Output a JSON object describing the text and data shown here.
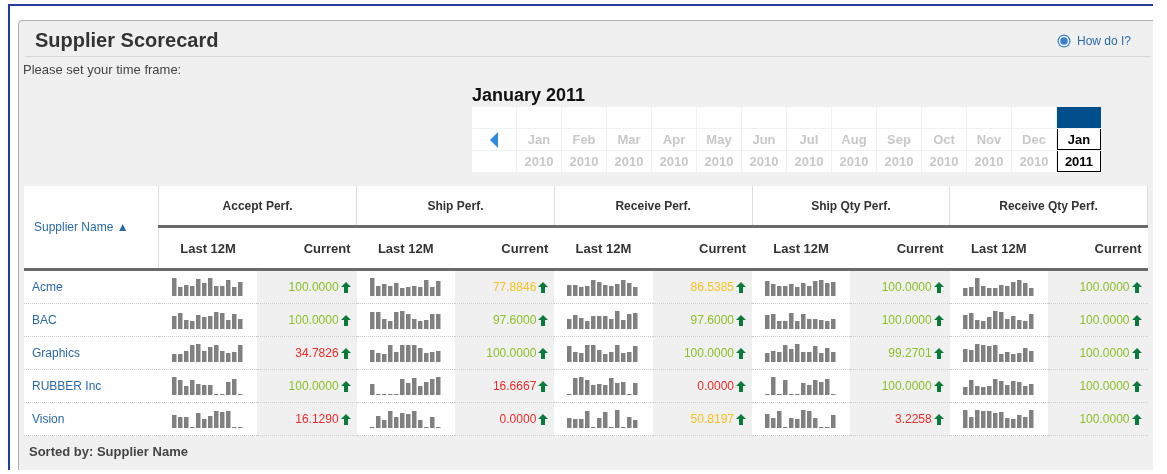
{
  "title": "Supplier Scorecard",
  "help_link": "How do I?",
  "time_frame_label": "Please set your time frame:",
  "calendar": {
    "title": "January 2011",
    "months": [
      {
        "month": "Jan",
        "year": "2010",
        "selected": false
      },
      {
        "month": "Feb",
        "year": "2010",
        "selected": false
      },
      {
        "month": "Mar",
        "year": "2010",
        "selected": false
      },
      {
        "month": "Apr",
        "year": "2010",
        "selected": false
      },
      {
        "month": "May",
        "year": "2010",
        "selected": false
      },
      {
        "month": "Jun",
        "year": "2010",
        "selected": false
      },
      {
        "month": "Jul",
        "year": "2010",
        "selected": false
      },
      {
        "month": "Aug",
        "year": "2010",
        "selected": false
      },
      {
        "month": "Sep",
        "year": "2010",
        "selected": false
      },
      {
        "month": "Oct",
        "year": "2010",
        "selected": false
      },
      {
        "month": "Nov",
        "year": "2010",
        "selected": false
      },
      {
        "month": "Dec",
        "year": "2010",
        "selected": false
      },
      {
        "month": "Jan",
        "year": "2011",
        "selected": true
      }
    ]
  },
  "table": {
    "name_column": "Supplier Name",
    "sort_arrow": "▲",
    "groups": [
      {
        "label": "Accept Perf.",
        "columns": [
          "Last 12M",
          "Current"
        ]
      },
      {
        "label": "Ship Perf.",
        "columns": [
          "Last 12M",
          "Current"
        ]
      },
      {
        "label": "Receive Perf.",
        "columns": [
          "Last 12M",
          "Current"
        ]
      },
      {
        "label": "Ship Qty Perf.",
        "columns": [
          "Last 12M",
          "Current"
        ]
      },
      {
        "label": "Receive Qty Perf.",
        "columns": [
          "Last 12M",
          "Current"
        ]
      }
    ],
    "rows": [
      {
        "name": "Acme",
        "cells": [
          {
            "current": "100.0000",
            "color": "#8cbf26"
          },
          {
            "current": "77.8846",
            "color": "#f5c223"
          },
          {
            "current": "86.5385",
            "color": "#f5c223"
          },
          {
            "current": "100.0000",
            "color": "#8cbf26"
          },
          {
            "current": "100.0000",
            "color": "#8cbf26"
          }
        ]
      },
      {
        "name": "BAC",
        "cells": [
          {
            "current": "100.0000",
            "color": "#8cbf26"
          },
          {
            "current": "97.6000",
            "color": "#8cbf26"
          },
          {
            "current": "97.6000",
            "color": "#8cbf26"
          },
          {
            "current": "100.0000",
            "color": "#8cbf26"
          },
          {
            "current": "100.0000",
            "color": "#8cbf26"
          }
        ]
      },
      {
        "name": "Graphics",
        "cells": [
          {
            "current": "34.7826",
            "color": "#ee2a2a"
          },
          {
            "current": "100.0000",
            "color": "#8cbf26"
          },
          {
            "current": "100.0000",
            "color": "#8cbf26"
          },
          {
            "current": "99.2701",
            "color": "#8cbf26"
          },
          {
            "current": "100.0000",
            "color": "#8cbf26"
          }
        ]
      },
      {
        "name": "RUBBER Inc",
        "cells": [
          {
            "current": "100.0000",
            "color": "#8cbf26"
          },
          {
            "current": "16.6667",
            "color": "#ee2a2a"
          },
          {
            "current": "0.0000",
            "color": "#ee2a2a"
          },
          {
            "current": "100.0000",
            "color": "#8cbf26"
          },
          {
            "current": "100.0000",
            "color": "#8cbf26"
          }
        ]
      },
      {
        "name": "Vision",
        "cells": [
          {
            "current": "16.1290",
            "color": "#ee2a2a"
          },
          {
            "current": "0.0000",
            "color": "#ee2a2a"
          },
          {
            "current": "50.8197",
            "color": "#f5c223"
          },
          {
            "current": "3.2258",
            "color": "#ee2a2a"
          },
          {
            "current": "100.0000",
            "color": "#8cbf26"
          }
        ]
      }
    ]
  },
  "footer": "Sorted by: Supplier Name"
}
